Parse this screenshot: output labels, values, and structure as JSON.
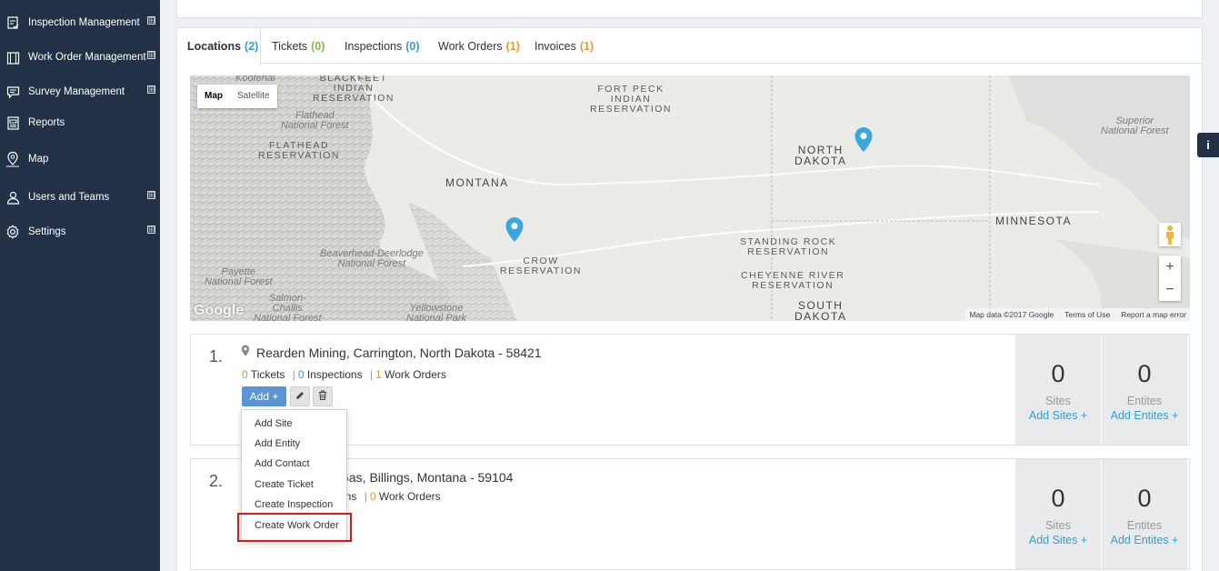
{
  "sidebar": {
    "items": [
      {
        "label": "Inspection Management",
        "icon": "clipboard-check-icon",
        "expandable": true
      },
      {
        "label": "Work Order Management",
        "icon": "clipboard-icon",
        "expandable": true
      },
      {
        "label": "Survey Management",
        "icon": "chat-icon",
        "expandable": true
      },
      {
        "label": "Reports",
        "icon": "report-icon",
        "expandable": false
      },
      {
        "label": "Map",
        "icon": "map-pin-icon",
        "expandable": false
      },
      {
        "label": "Users and Teams",
        "icon": "user-icon",
        "expandable": true
      },
      {
        "label": "Settings",
        "icon": "gear-icon",
        "expandable": true
      }
    ],
    "expand_symbol": "⊞"
  },
  "tabs": [
    {
      "label": "Locations",
      "count": "(2)",
      "active": true
    },
    {
      "label": "Tickets",
      "count": "(0)"
    },
    {
      "label": "Inspections",
      "count": "(0)"
    },
    {
      "label": "Work Orders",
      "count": "(1)"
    },
    {
      "label": "Invoices",
      "count": "(1)"
    }
  ],
  "map": {
    "type_map": "Map",
    "type_satellite": "Satellite",
    "labels": {
      "kootenai": "Kootenai",
      "blackfeet": "BLACKFEET\nINDIAN\nRESERVATION",
      "flathead_nf": "Flathead\nNational Forest",
      "flathead_res": "FLATHEAD\nRESERVATION",
      "montana": "MONTANA",
      "fort_peck": "FORT PECK\nINDIAN\nRESERVATION",
      "north_dakota": "NORTH\nDAKOTA",
      "superior": "Superior\nNational Forest",
      "minnesota": "MINNESOTA",
      "standing_rock": "STANDING ROCK\nRESERVATION",
      "cheyenne": "CHEYENNE RIVER\nRESERVATION",
      "south_dakota": "SOUTH\nDAKOTA",
      "crow": "CROW\nRESERVATION",
      "beaverhead": "Beaverhead-Deerlodge\nNational Forest",
      "payette": "Payette\nNational Forest",
      "salmon": "Salmon-\nChallis\nNational Forest",
      "yellowstone": "Yellowstone\nNational Park"
    },
    "google": "Google",
    "footer": [
      "Map data ©2017 Google",
      "Terms of Use",
      "Report a map error"
    ],
    "zoom_in": "+",
    "zoom_out": "−",
    "marker_color": "#3aa7e0"
  },
  "locations": [
    {
      "num": "1.",
      "title": "Rearden Mining, Carrington, North Dakota - 58421",
      "tickets": "0 Tickets",
      "inspections": "0 Inspections",
      "work_orders": "1 Work Orders",
      "tickets_n": "0",
      "tickets_t": "Tickets",
      "inspections_n": "0",
      "inspections_t": "Inspections",
      "work_orders_n": "1",
      "work_orders_t": "Work Orders",
      "sites": "0",
      "sites_label": "Sites",
      "add_sites": "Add Sites +",
      "entities": "0",
      "entities_label": "Entites",
      "add_entities": "Add Entites +",
      "add_button": "Add +"
    },
    {
      "num": "2.",
      "title_visible": "Gas, Billings, Montana - 59104",
      "inspections_partial": "ons",
      "work_orders_n": "0",
      "work_orders_t": "Work Orders",
      "sites": "0",
      "sites_label": "Sites",
      "add_sites": "Add Sites +",
      "entities": "0",
      "entities_label": "Entites",
      "add_entities": "Add Entites +"
    }
  ],
  "dropdown": {
    "items": [
      "Add Site",
      "Add Entity",
      "Add Contact",
      "Create Ticket",
      "Create Inspection",
      "Create Work Order"
    ],
    "highlighted": "Create Work Order"
  },
  "info_button": "i",
  "colors": {
    "sidebar_bg": "#223146",
    "accent_blue": "#2f9fd8",
    "green": "#7bbf3c",
    "orange": "#e59a2f",
    "add_button": "#5b95d3",
    "highlight": "#e0161b"
  }
}
